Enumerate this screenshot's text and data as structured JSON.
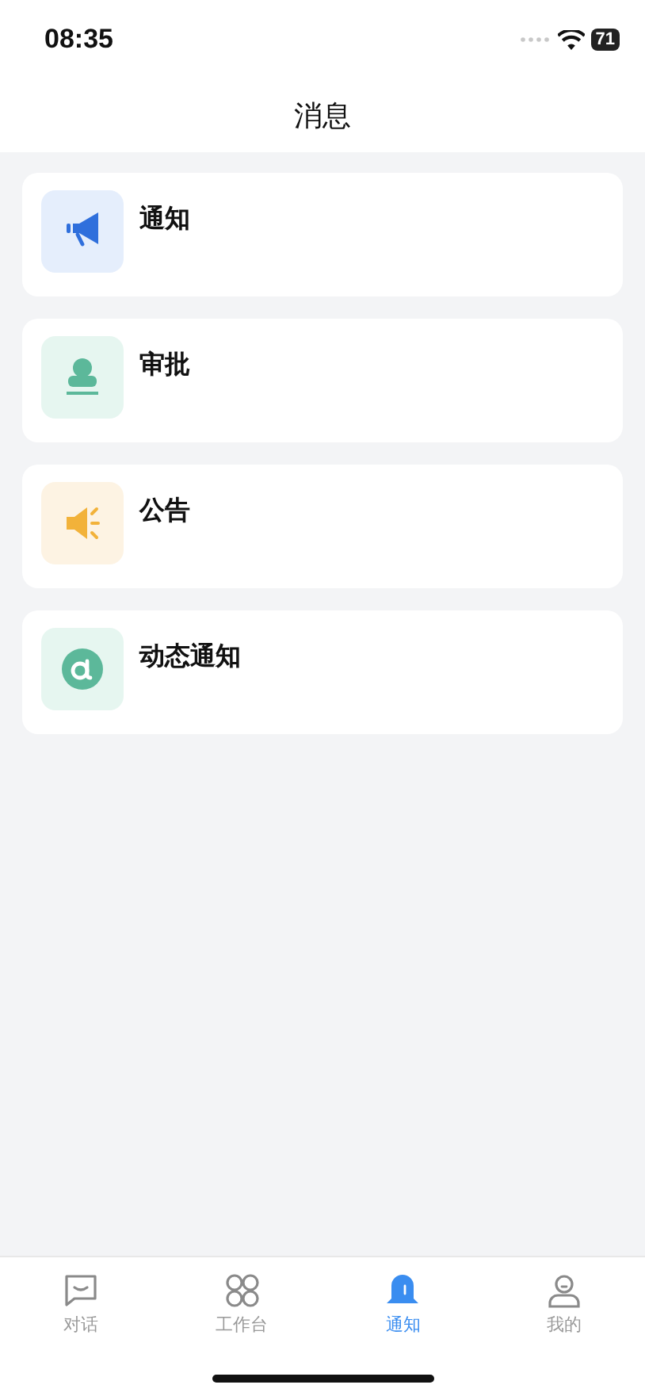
{
  "status_bar": {
    "time": "08:35",
    "battery": "71"
  },
  "header": {
    "title": "消息"
  },
  "items": [
    {
      "kind": "megaphone",
      "title": "通知"
    },
    {
      "kind": "stamp",
      "title": "审批"
    },
    {
      "kind": "speaker",
      "title": "公告"
    },
    {
      "kind": "mention",
      "title": "动态通知"
    }
  ],
  "tabs": [
    {
      "kind": "chat",
      "label": "对话",
      "selected": false
    },
    {
      "kind": "apps",
      "label": "工作台",
      "selected": false
    },
    {
      "kind": "bell",
      "label": "通知",
      "selected": true
    },
    {
      "kind": "person",
      "label": "我的",
      "selected": false
    }
  ]
}
